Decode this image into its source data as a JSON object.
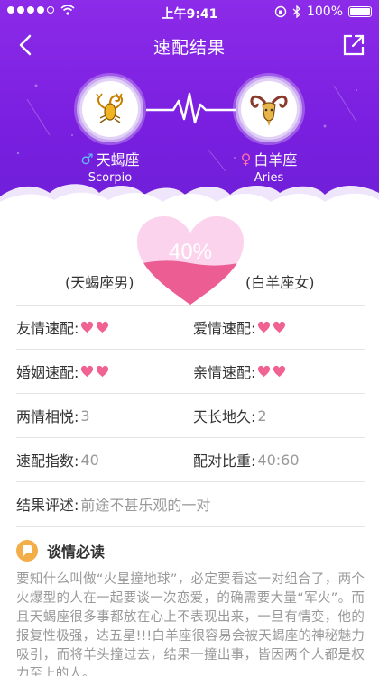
{
  "status_bar": {
    "time": "上午9:41",
    "battery": "100%"
  },
  "nav": {
    "title": "速配结果"
  },
  "male_sign": {
    "symbol": "♂",
    "name": "天蝎座",
    "en": "Scorpio"
  },
  "female_sign": {
    "symbol": "♀",
    "name": "白羊座",
    "en": "Aries"
  },
  "match": {
    "percent": "40%",
    "percent_value": 40,
    "left_label": "(天蝎座男)",
    "right_label": "(白羊座女)"
  },
  "rows": [
    {
      "left": {
        "label": "友情速配:",
        "hearts": 2
      },
      "right": {
        "label": "爱情速配:",
        "hearts": 2
      }
    },
    {
      "left": {
        "label": "婚姻速配:",
        "hearts": 2
      },
      "right": {
        "label": "亲情速配:",
        "hearts": 2
      }
    },
    {
      "left": {
        "label": "两情相悦:",
        "value": "3"
      },
      "right": {
        "label": "天长地久:",
        "value": "2"
      }
    },
    {
      "left": {
        "label": "速配指数:",
        "value": "40"
      },
      "right": {
        "label": "配对比重:",
        "value": "40:60"
      }
    }
  ],
  "result": {
    "label": "结果评述:",
    "value": "前途不甚乐观的一对"
  },
  "must_read": {
    "title": "谈情必读",
    "text": "要知什么叫做“火星撞地球”，必定要看这一对组合了，两个火爆型的人在一起要谈一次恋爱，的确需要大量“军火”。而且天蝎座很多事都放在心上不表现出来，一旦有情变，他的报复性极强，达五星!!!白羊座很容易会被天蝎座的神秘魅力吸引，而将羊头撞过去，结果一撞出事，皆因两个人都是权力至上的人。"
  },
  "colors": {
    "purple": "#7a1fe0",
    "heart_pink": "#f06292",
    "heart_light": "#fbd0ea"
  }
}
